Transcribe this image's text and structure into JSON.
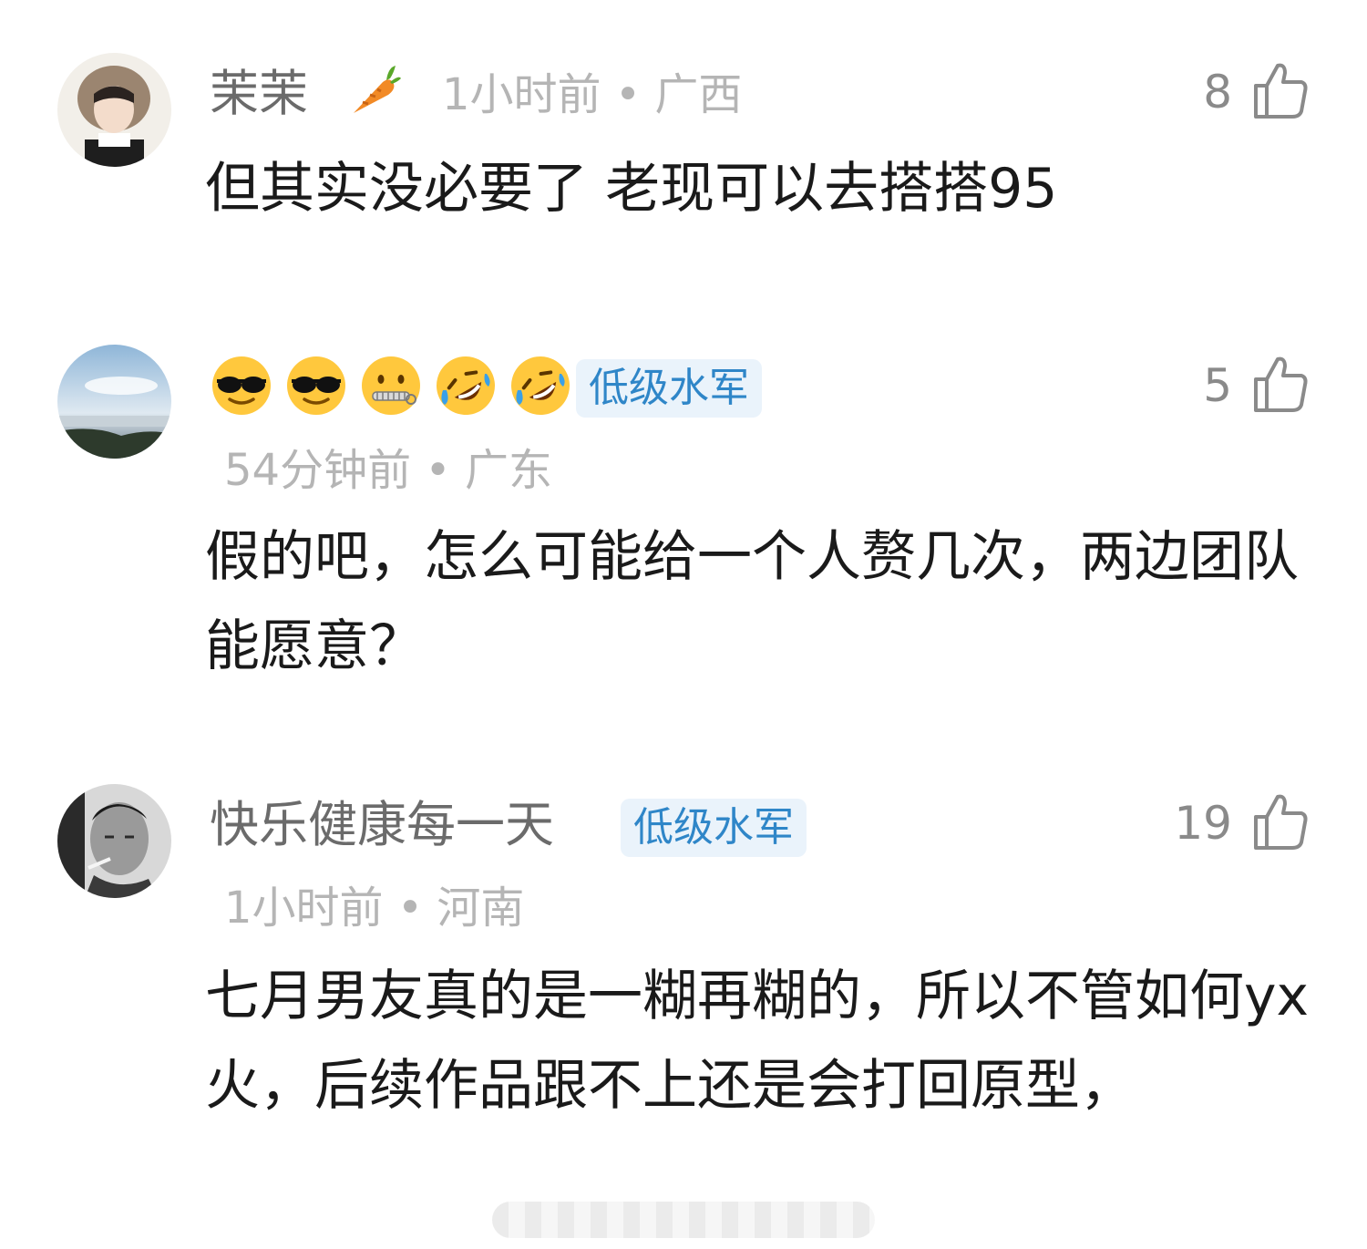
{
  "comments": [
    {
      "author": "茉茉",
      "author_emoji": "carrot-icon",
      "time": "1小时前",
      "location": "广西",
      "likes": "8",
      "body": "但其实没必要了 老现可以去搭搭95"
    },
    {
      "author_emojis": [
        "sunglasses-face-icon",
        "sunglasses-face-icon",
        "zipper-mouth-face-icon",
        "rofl-face-icon",
        "rofl-face-icon"
      ],
      "badge": "低级水军",
      "time": "54分钟前",
      "location": "广东",
      "likes": "5",
      "body": "假的吧，怎么可能给一个人赘几次，两边团队能愿意？"
    },
    {
      "author": "快乐健康每一天",
      "badge": "低级水军",
      "time": "1小时前",
      "location": "河南",
      "likes": "19",
      "body": "七月男友真的是一糊再糊的，所以不管如何yx火，后续作品跟不上还是会打回原型，"
    }
  ],
  "separator": "•",
  "colors": {
    "badge_bg": "#eaf3fb",
    "badge_text": "#2f86c8",
    "meta": "#b5b5b5"
  }
}
